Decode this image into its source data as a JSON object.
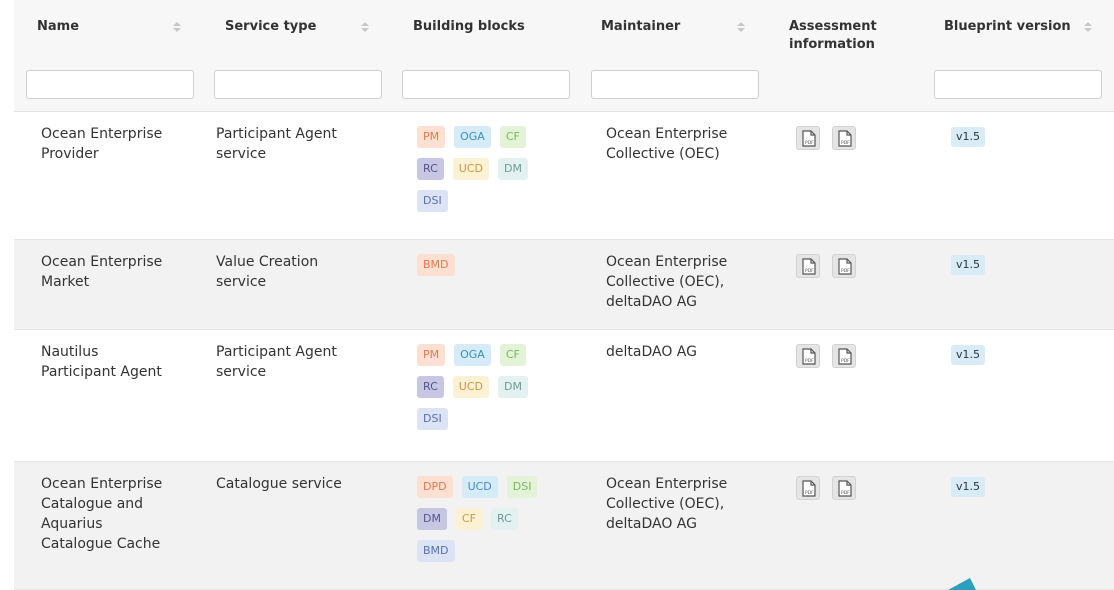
{
  "table": {
    "headers": {
      "name": "Name",
      "service_type": "Service type",
      "building_blocks": "Building blocks",
      "maintainer": "Maintainer",
      "assessment_line1": "Assessment",
      "assessment_line2": "information",
      "blueprint": "Blueprint version"
    },
    "filters": {
      "name": "",
      "service_type": "",
      "building_blocks": "",
      "maintainer": "",
      "blueprint": ""
    },
    "rows": [
      {
        "name": [
          "Ocean Enterprise",
          "Provider"
        ],
        "service_type": [
          "Participant Agent",
          "service"
        ],
        "tags": [
          "PM",
          "OGA",
          "CF",
          "RC",
          "UCD",
          "DM",
          "DSI"
        ],
        "maintainer": [
          "Ocean Enterprise",
          "Collective (OEC)"
        ],
        "pdf_label": "PDF",
        "version": "v1.5"
      },
      {
        "name": [
          "Ocean Enterprise",
          "Market"
        ],
        "service_type": [
          "Value Creation",
          "service"
        ],
        "tags": [
          "BMD"
        ],
        "maintainer": [
          "Ocean Enterprise",
          "Collective (OEC),",
          "deltaDAO AG"
        ],
        "pdf_label": "PDF",
        "version": "v1.5"
      },
      {
        "name": [
          "Nautilus",
          "Participant Agent"
        ],
        "service_type": [
          "Participant Agent",
          "service"
        ],
        "tags": [
          "PM",
          "OGA",
          "CF",
          "RC",
          "UCD",
          "DM",
          "DSI"
        ],
        "maintainer": [
          "deltaDAO AG"
        ],
        "pdf_label": "PDF",
        "version": "v1.5"
      },
      {
        "name": [
          "Ocean Enterprise",
          "Catalogue and",
          "Aquarius",
          "Catalogue Cache"
        ],
        "service_type": [
          "Catalogue service"
        ],
        "tags": [
          "DPD",
          "UCD",
          "DSI",
          "DM",
          "CF",
          "RC",
          "BMD"
        ],
        "maintainer": [
          "Ocean Enterprise",
          "Collective (OEC),",
          "deltaDAO AG"
        ],
        "pdf_label": "PDF",
        "version": "v1.5"
      }
    ]
  },
  "tag_colors": {
    "PM": {
      "bg": "#fde0d2",
      "fg": "#e07a52"
    },
    "OGA": {
      "bg": "#d5ecf8",
      "fg": "#3a8fc0"
    },
    "CF": {
      "bg": "#e3f3d8",
      "fg": "#7bb85a"
    },
    "RC": {
      "bg": "#c7c6e3",
      "fg": "#55548f"
    },
    "UCD": {
      "bg": "#fdf1d5",
      "fg": "#c99a3d"
    },
    "DM": {
      "bg": "#e3f1f1",
      "fg": "#6d9b9b"
    },
    "DSI": {
      "bg": "#dbe3f5",
      "fg": "#5b6fb0"
    },
    "BMD": {
      "bg": "#fde0d2",
      "fg": "#e07a52"
    },
    "DPD": {
      "bg": "#fde0d2",
      "fg": "#e07a52"
    }
  },
  "tag_colors_row4": {
    "DSI": {
      "bg": "#e3f3d8",
      "fg": "#7bb85a"
    },
    "DM": {
      "bg": "#c7c6e3",
      "fg": "#55548f"
    },
    "CF": {
      "bg": "#fdf1d5",
      "fg": "#c99a3d"
    },
    "RC": {
      "bg": "#e3f1f1",
      "fg": "#6d9b9b"
    },
    "BMD": {
      "bg": "#dbe3f5",
      "fg": "#5b6fb0"
    },
    "UCD": {
      "bg": "#d5ecf8",
      "fg": "#3a8fc0"
    }
  },
  "icons": {
    "sort": "sort-arrows-icon",
    "pdf": "pdf-document-icon"
  }
}
